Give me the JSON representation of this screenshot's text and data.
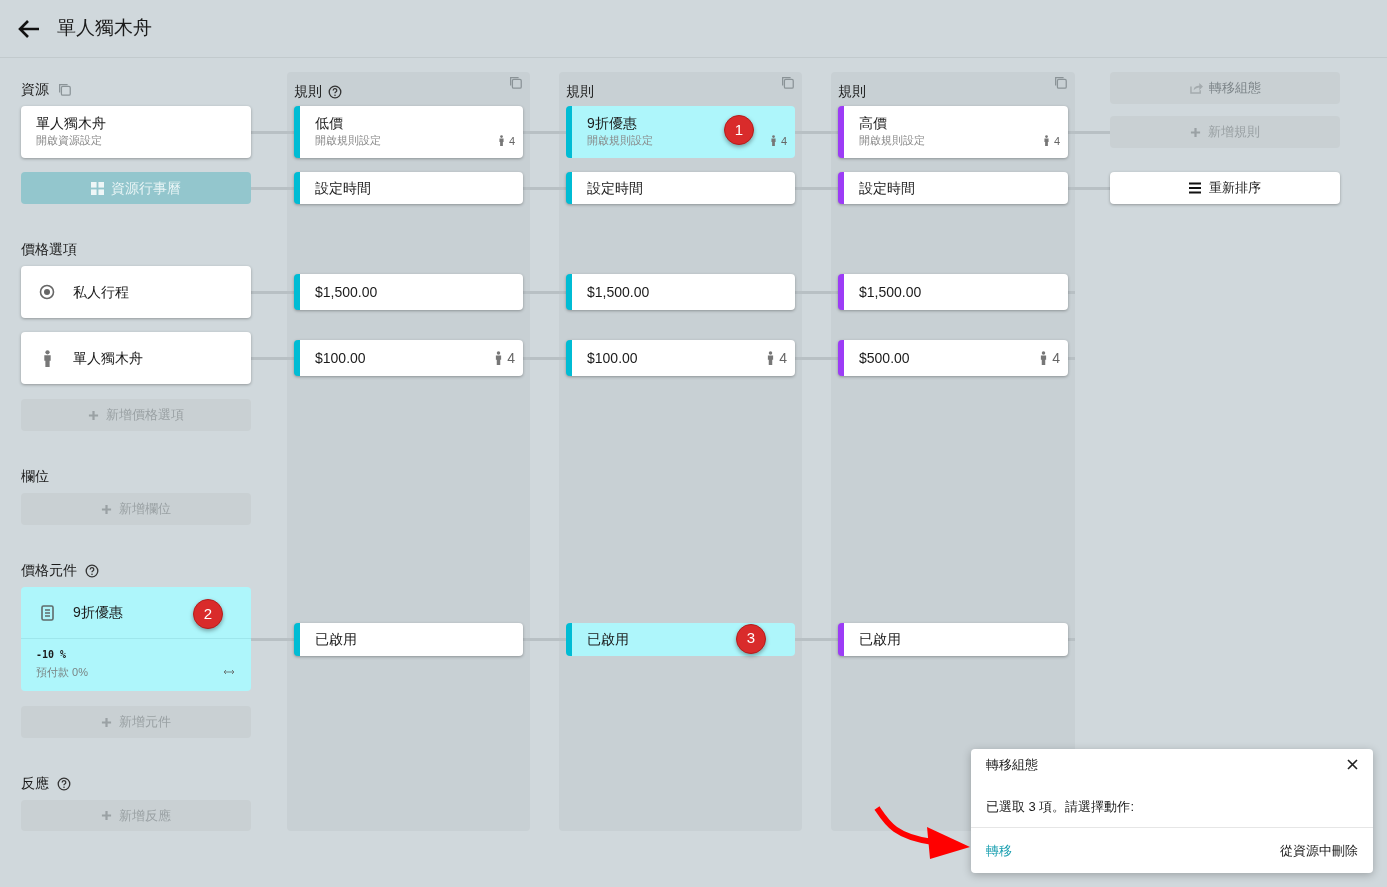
{
  "header": {
    "title": "單人獨木舟"
  },
  "resource": {
    "heading": "資源",
    "card": {
      "title": "單人獨木舟",
      "subtitle": "開啟資源設定"
    },
    "calendar_button": {
      "label": "資源行事曆",
      "disabled": true
    }
  },
  "price_options": {
    "heading": "價格選項",
    "items": [
      {
        "kind": "radio",
        "label": "私人行程"
      },
      {
        "kind": "person",
        "label": "單人獨木舟"
      }
    ],
    "add_button": "新增價格選項"
  },
  "slots": {
    "heading": "欄位",
    "add_button": "新增欄位"
  },
  "price_components": {
    "heading": "價格元件",
    "items": [
      {
        "title": "9折優惠",
        "value": "-10 %",
        "deposit": "預付款 0%",
        "selected": true,
        "badge": "2"
      }
    ],
    "add_button": "新增元件"
  },
  "reactions": {
    "heading": "反應",
    "add_button": "新增反應"
  },
  "rules": [
    {
      "heading": "規則",
      "help": true,
      "color": "#00bcd4",
      "card": {
        "title": "低價",
        "subtitle": "開啟規則設定",
        "capacity": "4",
        "selected": false
      },
      "time": "設定時間",
      "prices": [
        {
          "amount": "$1,500.00"
        },
        {
          "amount": "$100.00",
          "capacity": "4"
        }
      ],
      "component": {
        "label": "已啟用",
        "selected": false
      }
    },
    {
      "heading": "規則",
      "color": "#00bcd4",
      "card": {
        "title": "9折優惠",
        "subtitle": "開啟規則設定",
        "capacity": "4",
        "selected": true,
        "badge": "1"
      },
      "time": "設定時間",
      "prices": [
        {
          "amount": "$1,500.00"
        },
        {
          "amount": "$100.00",
          "capacity": "4"
        }
      ],
      "component": {
        "label": "已啟用",
        "selected": true,
        "badge": "3"
      }
    },
    {
      "heading": "規則",
      "color": "#9c3cf6",
      "card": {
        "title": "高價",
        "subtitle": "開啟規則設定",
        "capacity": "4",
        "selected": false
      },
      "time": "設定時間",
      "prices": [
        {
          "amount": "$1,500.00"
        },
        {
          "amount": "$500.00",
          "capacity": "4"
        }
      ],
      "component": {
        "label": "已啟用",
        "selected": false
      }
    }
  ],
  "actions": {
    "transfer": {
      "label": "轉移組態",
      "disabled": true
    },
    "add_rule": "新增規則",
    "reorder": "重新排序"
  },
  "toast": {
    "title": "轉移組態",
    "message": "已選取 3 項。請選擇動作:",
    "actions": [
      {
        "label": "轉移",
        "primary": true
      },
      {
        "label": "從資源中刪除",
        "primary": false
      }
    ]
  }
}
